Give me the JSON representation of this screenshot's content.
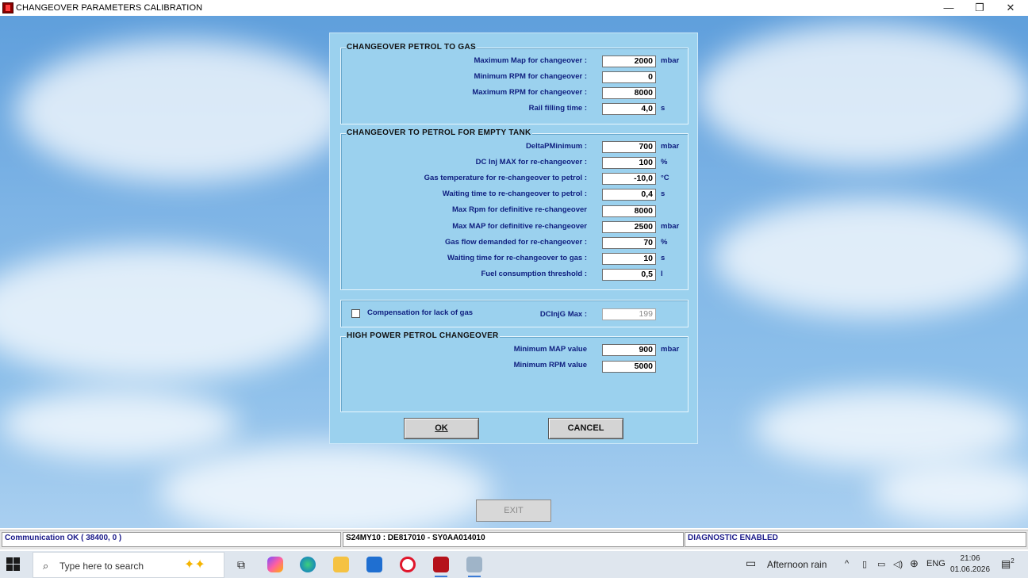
{
  "window": {
    "title": "CHANGEOVER PARAMETERS CALIBRATION",
    "minimize": "—",
    "maximize": "❐",
    "close": "✕"
  },
  "petrol_to_gas": {
    "title": "CHANGEOVER PETROL TO GAS",
    "rows": [
      {
        "label": "Maximum Map for changeover :",
        "value": "2000",
        "unit": "mbar"
      },
      {
        "label": "Minimum RPM for changeover :",
        "value": "0",
        "unit": ""
      },
      {
        "label": "Maximum RPM for changeover :",
        "value": "8000",
        "unit": ""
      },
      {
        "label": "Rail filling time :",
        "value": "4,0",
        "unit": "s"
      }
    ]
  },
  "empty_tank": {
    "title": "CHANGEOVER TO PETROL FOR EMPTY TANK",
    "rows": [
      {
        "label": "DeltaPMinimum :",
        "value": "700",
        "unit": "mbar"
      },
      {
        "label": "DC Inj MAX for re-changeover :",
        "value": "100",
        "unit": "%"
      },
      {
        "label": "Gas temperature for re-changeover to petrol :",
        "value": "-10,0",
        "unit": "°C"
      },
      {
        "label": "Waiting time to re-changeover to petrol :",
        "value": "0,4",
        "unit": "s"
      },
      {
        "label": "Max Rpm for definitive re-changeover",
        "value": "8000",
        "unit": ""
      },
      {
        "label": "Max MAP for definitive re-changeover",
        "value": "2500",
        "unit": "mbar"
      },
      {
        "label": "Gas flow demanded for re-changeover :",
        "value": "70",
        "unit": "%"
      },
      {
        "label": "Waiting time for re-changeover to gas :",
        "value": "10",
        "unit": "s"
      },
      {
        "label": "Fuel consumption threshold :",
        "value": "0,5",
        "unit": "l"
      }
    ]
  },
  "compensation": {
    "checkbox_label": "Compensation for lack of gas",
    "checked": false,
    "dcinjg_label": "DCInjG Max :",
    "dcinjg_value": "199"
  },
  "high_power": {
    "title": "HIGH POWER PETROL CHANGEOVER",
    "rows": [
      {
        "label": "Minimum MAP value",
        "value": "900",
        "unit": "mbar"
      },
      {
        "label": "Minimum RPM value",
        "value": "5000",
        "unit": ""
      }
    ]
  },
  "buttons": {
    "ok": "OK",
    "cancel": "CANCEL",
    "exit": "EXIT"
  },
  "statusbar": {
    "communication": "Communication OK ( 38400,  0 )",
    "ecu": "S24MY10 : DE817010 - SY0AA014010",
    "diagnostic": "DIAGNOSTIC ENABLED"
  },
  "taskbar": {
    "search_placeholder": "Type here to search",
    "weather": "Afternoon rain",
    "language": "ENG",
    "time": "21:06",
    "date": "01.06.2026",
    "notifications": "2"
  }
}
